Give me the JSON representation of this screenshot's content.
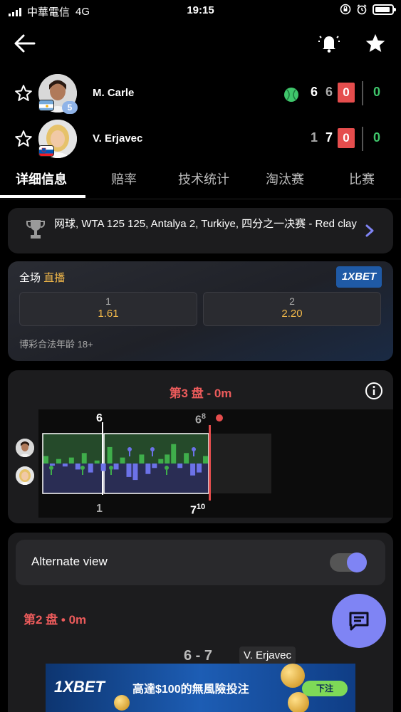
{
  "status_bar": {
    "carrier": "中華電信",
    "network": "4G",
    "time": "19:15"
  },
  "players": [
    {
      "name": "M. Carle",
      "seed": "5",
      "set1": "6",
      "set2": "6",
      "game": "0",
      "point": "0",
      "serving": true
    },
    {
      "name": "V. Erjavec",
      "seed": "",
      "set1": "1",
      "set2": "7",
      "game": "0",
      "point": "0",
      "serving": false
    }
  ],
  "tabs": [
    "详细信息",
    "赔率",
    "技术统计",
    "淘汰赛",
    "比赛"
  ],
  "active_tab": "详细信息",
  "league": {
    "text": "网球, WTA 125 125, Antalya 2, Turkiye, 四分之一决赛 - Red clay"
  },
  "odds": {
    "label": "全场",
    "live": "直播",
    "bookmaker": "1XBET",
    "options": [
      {
        "key": "1",
        "value": "1.61"
      },
      {
        "key": "2",
        "value": "2.20"
      }
    ],
    "legal": "博彩合法年龄 18+"
  },
  "momentum": {
    "title": "第3 盘 - 0m",
    "top_left_score": "6",
    "top_right_score": "6",
    "top_right_tiebreak": "8",
    "bottom_left_score": "1",
    "bottom_right_score": "7",
    "bottom_right_tiebreak": "10",
    "bars": [
      0.25,
      -0.05,
      0.15,
      -0.1,
      0.2,
      -0.2,
      0.35,
      -0.3,
      0.1,
      -0.25,
      0.55,
      -0.2,
      0.2,
      -0.45,
      -0.55,
      0.3,
      -0.35,
      -0.15,
      0.15,
      0.3,
      0.65,
      -0.15,
      0.35,
      -0.4,
      -0.3,
      0.25
    ]
  },
  "alternate_view": {
    "label": "Alternate view",
    "enabled": true
  },
  "set2": {
    "title": "第2 盘 • 0m",
    "score": "6 - 7",
    "winner": "V. Erjavec"
  },
  "ad": {
    "brand": "1XBET",
    "slogan": "高達$100的無風險投注",
    "cta": "下注"
  },
  "colors": {
    "accent": "#7f84f4",
    "live": "#f3b94a",
    "set_title": "#ec5b5b",
    "serve": "#3fc66b",
    "game_box": "#e54d4d",
    "momentum_top": "#2f8a3a",
    "momentum_bottom": "#6c72e8"
  }
}
